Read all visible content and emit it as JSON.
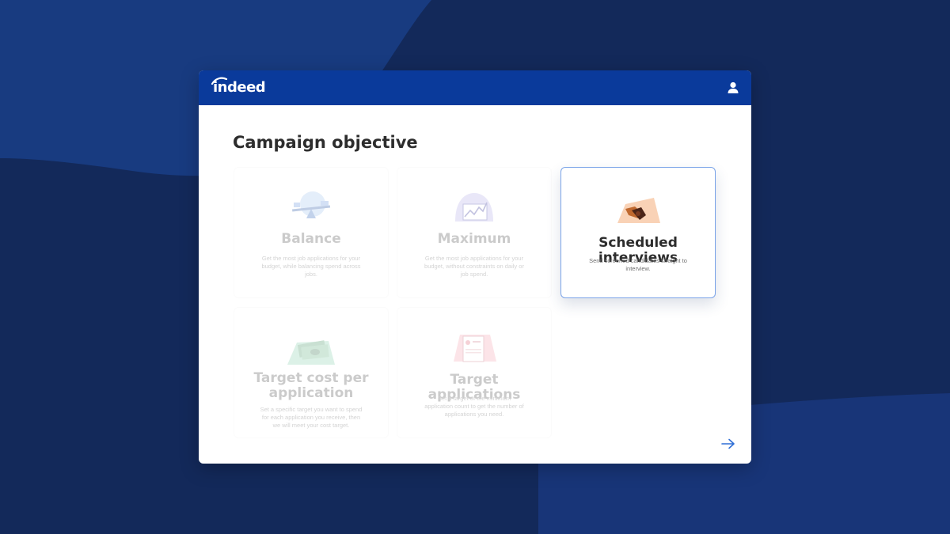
{
  "app": {
    "brand": "indeed",
    "colors": {
      "background": "#13295a",
      "header": "#0a3a9b",
      "accent": "#2f6fd6",
      "selected_border": "#7aa3e8"
    }
  },
  "header": {
    "logo_text": "indeed",
    "user_icon": "user-icon"
  },
  "main": {
    "title": "Campaign objective",
    "objectives": [
      {
        "title": "Balance",
        "description": "Get the most job applications for your budget, while balancing spend across jobs.",
        "icon": "seesaw-illustration",
        "state": "disabled"
      },
      {
        "title": "Maximum",
        "description": "Get the most job applications for your budget, without constraints on daily or job spend.",
        "icon": "growth-chart-illustration",
        "state": "disabled"
      },
      {
        "title": "Scheduled interviews",
        "description": "Send screened candidates straight to interview.",
        "icon": "handshake-illustration",
        "state": "selected"
      },
      {
        "title": "Target cost per application",
        "description": "Set a specific target you want to spend for each application you receive, then we will meet your cost target.",
        "icon": "money-illustration",
        "state": "disabled"
      },
      {
        "title": "Target applications",
        "description": "Set a target of the minimum application count to get the number of applications you need.",
        "icon": "resume-illustration",
        "state": "disabled"
      }
    ],
    "next_icon": "arrow-right-icon"
  }
}
